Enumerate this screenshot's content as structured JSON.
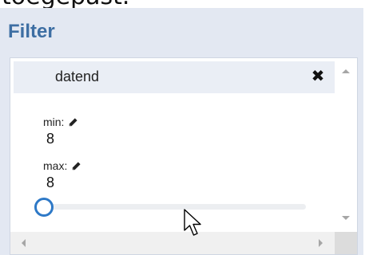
{
  "page": {
    "heading_fragment": "toegepast."
  },
  "filter_panel": {
    "title": "Filter",
    "accent_color": "#3d6ea3",
    "background_color": "#e3e8f2"
  },
  "filter_card": {
    "title": "datend",
    "close_icon": "close-icon",
    "min_label": "min:",
    "min_value": "8",
    "max_label": "max:",
    "max_value": "8",
    "edit_icon": "pencil-icon"
  },
  "range_slider": {
    "handle_color": "#2e79c7",
    "value_fraction": 0
  },
  "icons": {
    "cursor": "mouse-pointer-icon",
    "scroll_up": "scroll-up-arrow-icon",
    "scroll_down": "scroll-down-arrow-icon",
    "scroll_left": "scroll-left-arrow-icon",
    "scroll_right": "scroll-right-arrow-icon"
  }
}
